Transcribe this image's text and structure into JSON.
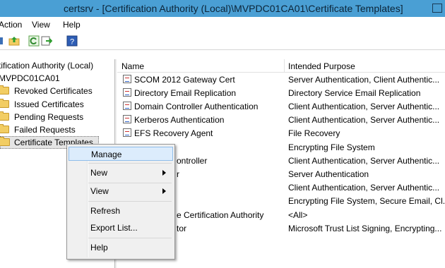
{
  "window": {
    "title": "certsrv - [Certification Authority (Local)\\MVPDC01CA01\\Certificate Templates]"
  },
  "menubar": {
    "items": [
      "Action",
      "View",
      "Help"
    ]
  },
  "toolbar": {
    "icons": [
      "up-folder-icon",
      "refresh-icon",
      "export-icon",
      "help-icon"
    ]
  },
  "tree": {
    "root": "tification Authority (Local)",
    "ca": "MVPDC01CA01",
    "children": [
      "Revoked Certificates",
      "Issued Certificates",
      "Pending Requests",
      "Failed Requests",
      "Certificate Templates"
    ]
  },
  "list": {
    "headers": {
      "name": "Name",
      "purpose": "Intended Purpose"
    },
    "rows": [
      {
        "name": "SCOM 2012 Gateway Cert",
        "purpose": "Server Authentication, Client Authentic..."
      },
      {
        "name": "Directory Email Replication",
        "purpose": "Directory Service Email Replication"
      },
      {
        "name": "Domain Controller Authentication",
        "purpose": "Client Authentication, Server Authentic..."
      },
      {
        "name": "Kerberos Authentication",
        "purpose": "Client Authentication, Server Authentic..."
      },
      {
        "name": "EFS Recovery Agent",
        "purpose": "File Recovery"
      },
      {
        "name": "",
        "purpose": "Encrypting File System"
      },
      {
        "name": "ontroller",
        "purpose": "Client Authentication, Server Authentic..."
      },
      {
        "name": "r",
        "purpose": "Server Authentication"
      },
      {
        "name": "",
        "purpose": "Client Authentication, Server Authentic..."
      },
      {
        "name": "",
        "purpose": "Encrypting File System, Secure Email, Cl..."
      },
      {
        "name": "e Certification Authority",
        "purpose": "<All>"
      },
      {
        "name": "tor",
        "purpose": "Microsoft Trust List Signing, Encrypting..."
      }
    ]
  },
  "context_menu": {
    "manage": "Manage",
    "new": "New",
    "view": "View",
    "refresh": "Refresh",
    "export": "Export List...",
    "help": "Help"
  },
  "colors": {
    "titlebar": "#4a9fd4",
    "highlight": "#dcecfc",
    "menu_bg": "#f0f0f0"
  }
}
